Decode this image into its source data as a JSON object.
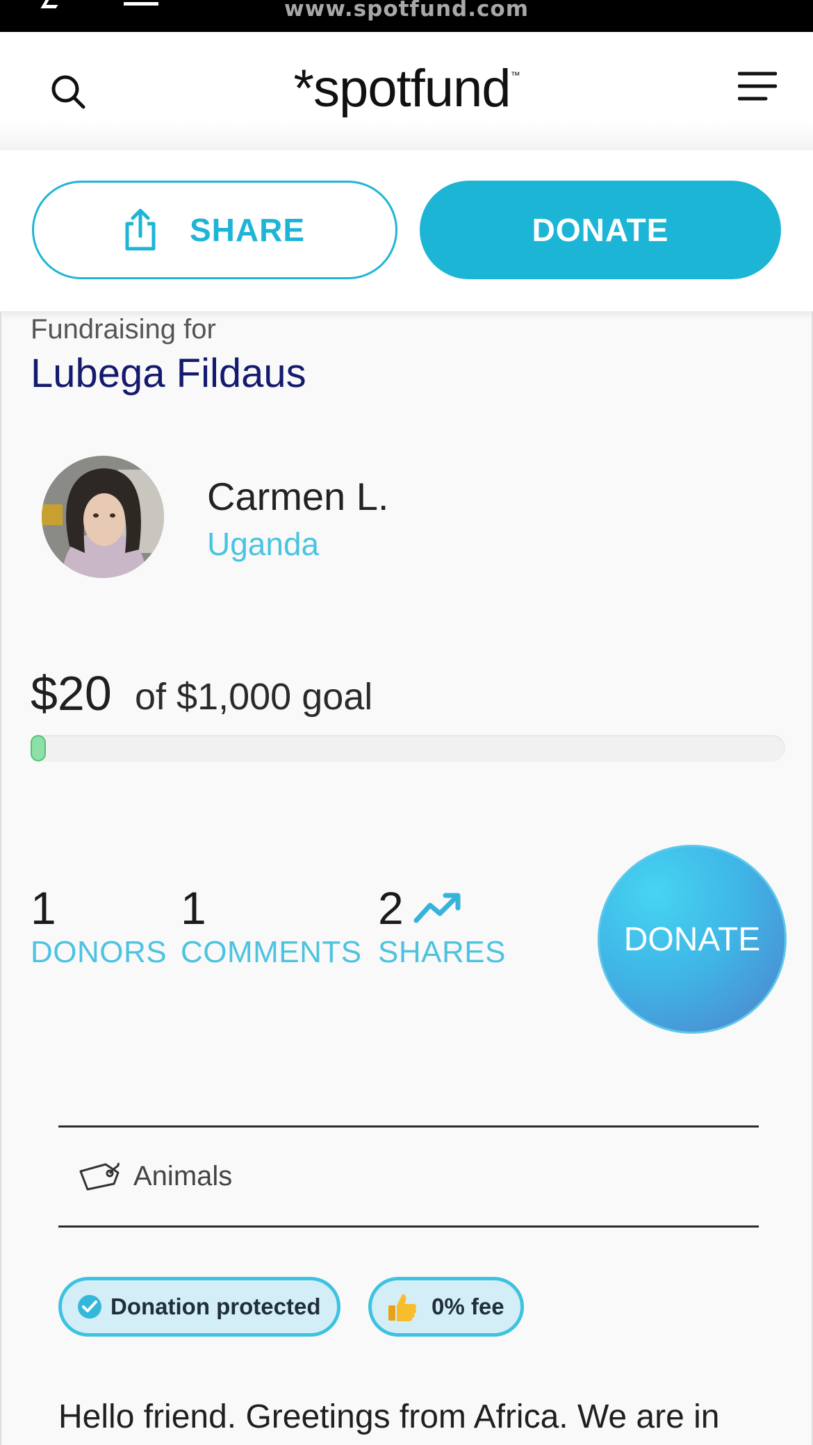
{
  "browser": {
    "url": "www.spotfund.com"
  },
  "header": {
    "logo": "*spotfund",
    "logo_tm": "™"
  },
  "action_bar": {
    "share_label": "SHARE",
    "donate_label": "DONATE"
  },
  "fundraiser": {
    "for_label": "Fundraising for",
    "beneficiary": "Lubega Fildaus",
    "organizer_name": "Carmen L.",
    "organizer_location": "Uganda",
    "raised": "$20",
    "goal_text": "of $1,000 goal",
    "progress_fraction": 0.02
  },
  "stats": {
    "donors": {
      "count": "1",
      "label": "DONORS"
    },
    "comments": {
      "count": "1",
      "label": "COMMENTS"
    },
    "shares": {
      "count": "2",
      "label": "SHARES"
    },
    "donate_button": "DONATE"
  },
  "category": {
    "label": "Animals"
  },
  "badges": {
    "protected": "Donation protected",
    "fee": "0% fee"
  },
  "story": {
    "first_line": "Hello friend. Greetings from Africa. We are in"
  },
  "colors": {
    "accent": "#1db5d6",
    "beneficiary": "#141a6e",
    "progress": "#8ee0a8"
  }
}
